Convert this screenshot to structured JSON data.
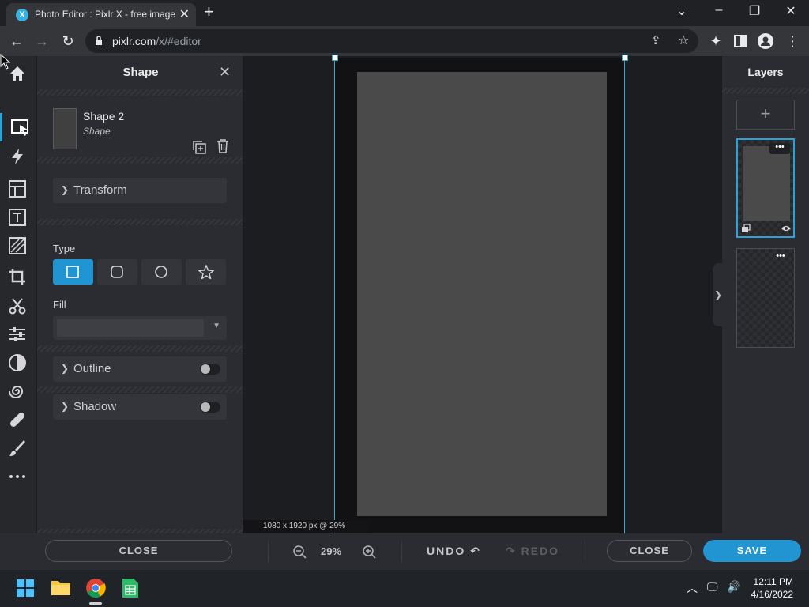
{
  "browser": {
    "tab_title": "Photo Editor : Pixlr X - free image editing online",
    "tab_favicon": "X",
    "url_host": "pixlr.com",
    "url_path": "/x/#editor",
    "icons": [
      "back-icon",
      "forward-icon",
      "reload-icon",
      "lock-icon",
      "share-icon",
      "star-icon",
      "extensions-icon",
      "sidepanel-icon",
      "profile-icon",
      "menu-icon"
    ]
  },
  "panel": {
    "title": "Shape",
    "shape_name": "Shape 2",
    "shape_kind": "Shape",
    "transform_label": "Transform",
    "type_label": "Type",
    "fill_label": "Fill",
    "outline_label": "Outline",
    "shadow_label": "Shadow",
    "close_label": "CLOSE",
    "outline_enabled": false,
    "shadow_enabled": false
  },
  "canvas": {
    "doc_info": "1080 x 1920 px @ 29%",
    "shape_color": "#4a4a4a"
  },
  "layers": {
    "title": "Layers",
    "add_label": "+",
    "menu_label": "•••"
  },
  "bottom": {
    "zoom": "29%",
    "undo": "UNDO",
    "redo": "REDO",
    "close": "CLOSE",
    "save": "SAVE"
  },
  "colors": {
    "accent": "#2195d2"
  },
  "taskbar": {
    "time": "12:11 PM",
    "date": "4/16/2022"
  }
}
